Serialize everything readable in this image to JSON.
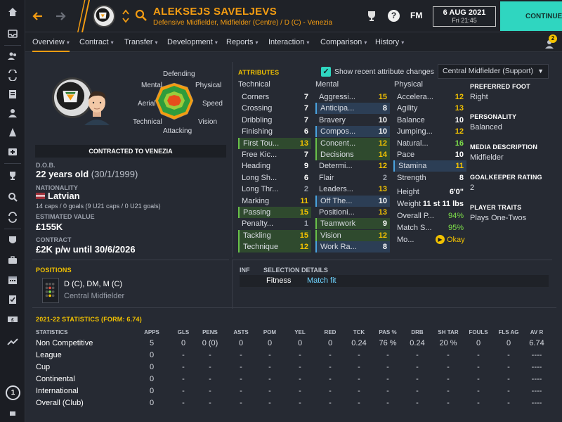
{
  "header": {
    "player_name": "ALEKSEJS SAVELJEVS",
    "player_subtitle": "Defensive Midfielder, Midfielder (Centre) / D (C) - Venezia",
    "date": "6 AUG 2021",
    "time": "Fri 21:45",
    "fm_label": "FM",
    "continue_label": "CONTINUE",
    "notification_count": "2"
  },
  "subnav": [
    "Overview",
    "Contract",
    "Transfer",
    "Development",
    "Reports",
    "Interaction",
    "Comparison",
    "History"
  ],
  "profile": {
    "polar_labels": {
      "defending": "Defending",
      "mental": "Mental",
      "physical": "Physical",
      "aerial": "Aerial",
      "speed": "Speed",
      "technical": "Technical",
      "vision": "Vision",
      "attacking": "Attacking"
    },
    "contract_banner": "CONTRACTED TO VENEZIA",
    "dob_label": "D.O.B.",
    "dob_value": "22 years old",
    "dob_date": "(30/1/1999)",
    "nationality_label": "NATIONALITY",
    "nationality_value": "Latvian",
    "caps_text": "14 caps / 0 goals (9 U21 caps / 0 U21 goals)",
    "value_label": "ESTIMATED VALUE",
    "value_value": "£155K",
    "contract_label": "CONTRACT",
    "contract_value": "£2K p/w until 30/6/2026"
  },
  "attributes": {
    "title": "ATTRIBUTES",
    "show_recent_label": "Show recent attribute changes",
    "role_select": "Central Midfielder (Support)",
    "technical_header": "Technical",
    "mental_header": "Mental",
    "physical_header": "Physical",
    "technical": [
      {
        "name": "Corners",
        "value": "7"
      },
      {
        "name": "Crossing",
        "value": "7"
      },
      {
        "name": "Dribbling",
        "value": "7"
      },
      {
        "name": "Finishing",
        "value": "6"
      },
      {
        "name": "First Tou...",
        "value": "13"
      },
      {
        "name": "Free Kic...",
        "value": "7"
      },
      {
        "name": "Heading",
        "value": "9"
      },
      {
        "name": "Long Sh...",
        "value": "6"
      },
      {
        "name": "Long Thr...",
        "value": "2"
      },
      {
        "name": "Marking",
        "value": "11"
      },
      {
        "name": "Passing",
        "value": "15"
      },
      {
        "name": "Penalty...",
        "value": "1"
      },
      {
        "name": "Tackling",
        "value": "15"
      },
      {
        "name": "Technique",
        "value": "12"
      }
    ],
    "mental": [
      {
        "name": "Aggressi...",
        "value": "15"
      },
      {
        "name": "Anticipa...",
        "value": "8"
      },
      {
        "name": "Bravery",
        "value": "10"
      },
      {
        "name": "Compos...",
        "value": "10"
      },
      {
        "name": "Concent...",
        "value": "12"
      },
      {
        "name": "Decisions",
        "value": "14"
      },
      {
        "name": "Determi...",
        "value": "12"
      },
      {
        "name": "Flair",
        "value": "2"
      },
      {
        "name": "Leaders...",
        "value": "13"
      },
      {
        "name": "Off The...",
        "value": "10"
      },
      {
        "name": "Positioni...",
        "value": "13"
      },
      {
        "name": "Teamwork",
        "value": "9"
      },
      {
        "name": "Vision",
        "value": "12"
      },
      {
        "name": "Work Ra...",
        "value": "8"
      }
    ],
    "physical": [
      {
        "name": "Accelera...",
        "value": "12"
      },
      {
        "name": "Agility",
        "value": "13"
      },
      {
        "name": "Balance",
        "value": "10"
      },
      {
        "name": "Jumping...",
        "value": "12"
      },
      {
        "name": "Natural...",
        "value": "16"
      },
      {
        "name": "Pace",
        "value": "10"
      },
      {
        "name": "Stamina",
        "value": "11"
      },
      {
        "name": "Strength",
        "value": "8"
      }
    ],
    "height_label": "Height",
    "height_value": "6'0\"",
    "weight_label": "Weight",
    "weight_value": "11 st 11 lbs",
    "overall_label": "Overall P...",
    "overall_value": "94%",
    "match_label": "Match S...",
    "match_value": "95%",
    "morale_label": "Mo...",
    "morale_value": "Okay"
  },
  "info": {
    "foot_label": "PREFERRED FOOT",
    "foot_value": "Right",
    "personality_label": "PERSONALITY",
    "personality_value": "Balanced",
    "media_label": "MEDIA DESCRIPTION",
    "media_value": "Midfielder",
    "gk_label": "GOALKEEPER RATING",
    "gk_value": "2",
    "traits_label": "PLAYER TRAITS",
    "traits_value": "Plays One-Twos"
  },
  "positions": {
    "title": "POSITIONS",
    "main": "D (C), DM, M (C)",
    "role": "Central Midfielder",
    "inf_label": "INF",
    "selection_label": "SELECTION DETAILS",
    "fitness_label": "Fitness",
    "fitness_value": "Match fit"
  },
  "stats": {
    "title": "2021-22 STATISTICS (FORM: 6.74)",
    "columns": [
      "STATISTICS",
      "APPS",
      "GLS",
      "PENS",
      "ASTS",
      "POM",
      "YEL",
      "RED",
      "TCK",
      "PAS %",
      "DRB",
      "SH TAR",
      "FOULS",
      "FLS AG",
      "AV R"
    ],
    "rows": [
      [
        "Non Competitive",
        "5",
        "0",
        "0 (0)",
        "0",
        "0",
        "0",
        "0",
        "0.24",
        "76 %",
        "0.24",
        "20 %",
        "0",
        "0",
        "6.74"
      ],
      [
        "League",
        "0",
        "-",
        "-",
        "-",
        "-",
        "-",
        "-",
        "-",
        "-",
        "-",
        "-",
        "-",
        "-",
        "----"
      ],
      [
        "Cup",
        "0",
        "-",
        "-",
        "-",
        "-",
        "-",
        "-",
        "-",
        "-",
        "-",
        "-",
        "-",
        "-",
        "----"
      ],
      [
        "Continental",
        "0",
        "-",
        "-",
        "-",
        "-",
        "-",
        "-",
        "-",
        "-",
        "-",
        "-",
        "-",
        "-",
        "----"
      ],
      [
        "International",
        "0",
        "-",
        "-",
        "-",
        "-",
        "-",
        "-",
        "-",
        "-",
        "-",
        "-",
        "-",
        "-",
        "----"
      ],
      [
        "Overall (Club)",
        "0",
        "-",
        "-",
        "-",
        "-",
        "-",
        "-",
        "-",
        "-",
        "-",
        "-",
        "-",
        "-",
        "----"
      ]
    ]
  },
  "sidebar": {
    "badge": "1",
    "icons": [
      "home-icon",
      "inbox-icon",
      "squad-icon",
      "tactics-icon",
      "reports-icon",
      "staff-icon",
      "training-icon",
      "medical-icon",
      "competitions-icon",
      "scouting-icon",
      "transfers-icon",
      "club-info-icon",
      "finances-icon",
      "schedule-icon",
      "clipboard-icon",
      "money-icon",
      "trend-icon"
    ]
  },
  "colors": {
    "accent_orange": "#f39c12",
    "accent_yellow": "#f2c200",
    "continue_teal": "#2fd6c0",
    "value_green": "#7ee04a",
    "value_yellow": "#f2c200",
    "value_white": "#ffffff"
  }
}
